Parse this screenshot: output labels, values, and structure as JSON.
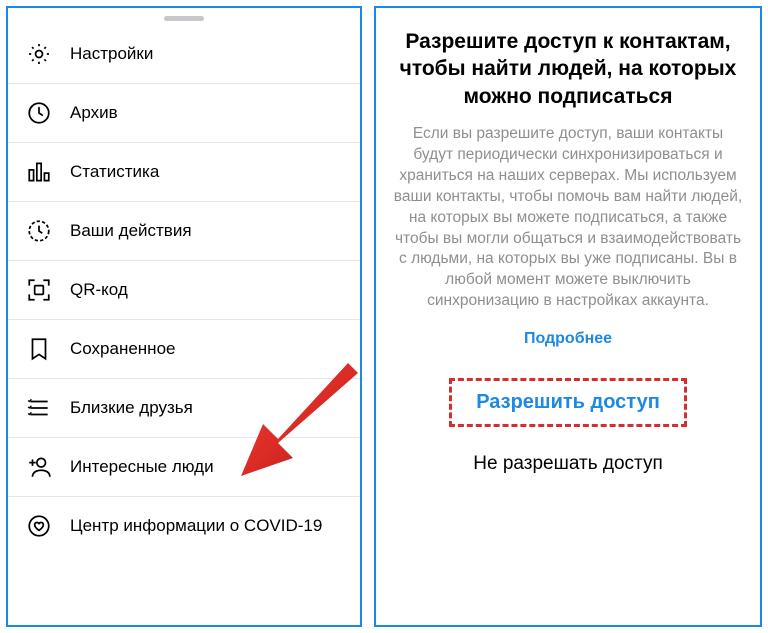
{
  "menu": {
    "items": [
      {
        "label": "Настройки"
      },
      {
        "label": "Архив"
      },
      {
        "label": "Статистика"
      },
      {
        "label": "Ваши действия"
      },
      {
        "label": "QR-код"
      },
      {
        "label": "Сохраненное"
      },
      {
        "label": "Близкие друзья"
      },
      {
        "label": "Интересные люди"
      },
      {
        "label": "Центр информации о COVID-19"
      }
    ]
  },
  "dialog": {
    "title": "Разрешите доступ к контактам, чтобы найти людей, на которых можно подписаться",
    "body": "Если вы разрешите доступ, ваши контакты будут периодически синхронизироваться и храниться на наших серверах. Мы используем ваши контакты, чтобы помочь вам найти людей, на которых вы можете подписаться, а также чтобы вы могли общаться и взаимодействовать с людьми, на которых вы уже подписаны. Вы в любой момент можете выключить синхронизацию в настройках аккаунта.",
    "learn_more": "Подробнее",
    "allow": "Разрешить доступ",
    "deny": "Не разрешать доступ"
  },
  "colors": {
    "accent": "#1e88e5",
    "highlight_border": "#d32f2f",
    "muted_text": "#8e8e93"
  }
}
